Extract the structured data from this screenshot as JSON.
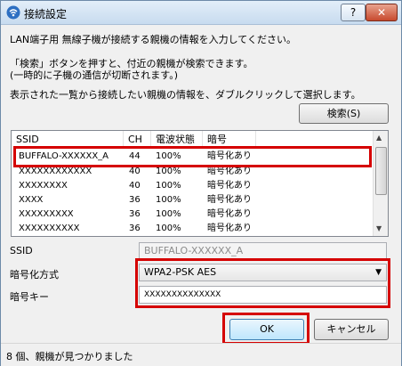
{
  "window": {
    "title": "接続設定",
    "help_label": "?",
    "close_label": "✕",
    "icon": "wifi-signal-icon"
  },
  "instructions": {
    "line1": "LAN端子用 無線子機が接続する親機の情報を入力してください。",
    "line2": "「検索」ボタンを押すと、付近の親機が検索できます。",
    "line3": "(一時的に子機の通信が切断されます。)",
    "line4": "表示された一覧から接続したい親機の情報を、ダブルクリックして選択します。"
  },
  "search_button": {
    "label": "検索(S)"
  },
  "list": {
    "columns": [
      "SSID",
      "CH",
      "電波状態",
      "暗号"
    ],
    "rows": [
      {
        "ssid": "BUFFALO-XXXXXX_A",
        "ch": "44",
        "signal": "100%",
        "enc": "暗号化あり",
        "selected": true
      },
      {
        "ssid": "XXXXXXXXXXXX",
        "ch": "40",
        "signal": "100%",
        "enc": "暗号化あり"
      },
      {
        "ssid": "XXXXXXXX",
        "ch": "40",
        "signal": "100%",
        "enc": "暗号化あり"
      },
      {
        "ssid": "XXXX",
        "ch": "36",
        "signal": "100%",
        "enc": "暗号化あり"
      },
      {
        "ssid": "XXXXXXXXX",
        "ch": "36",
        "signal": "100%",
        "enc": "暗号化あり"
      },
      {
        "ssid": "XXXXXXXXXX",
        "ch": "36",
        "signal": "100%",
        "enc": "暗号化あり"
      }
    ]
  },
  "form": {
    "ssid_label": "SSID",
    "ssid_value": "BUFFALO-XXXXXX_A",
    "encryption_label": "暗号化方式",
    "encryption_value": "WPA2-PSK AES",
    "key_label": "暗号キー",
    "key_value": "XXXXXXXXXXXXXX"
  },
  "buttons": {
    "ok": "OK",
    "cancel": "キャンセル"
  },
  "status": {
    "text": "8 個、親機が見つかりました"
  },
  "colors": {
    "highlight": "#d50000"
  }
}
